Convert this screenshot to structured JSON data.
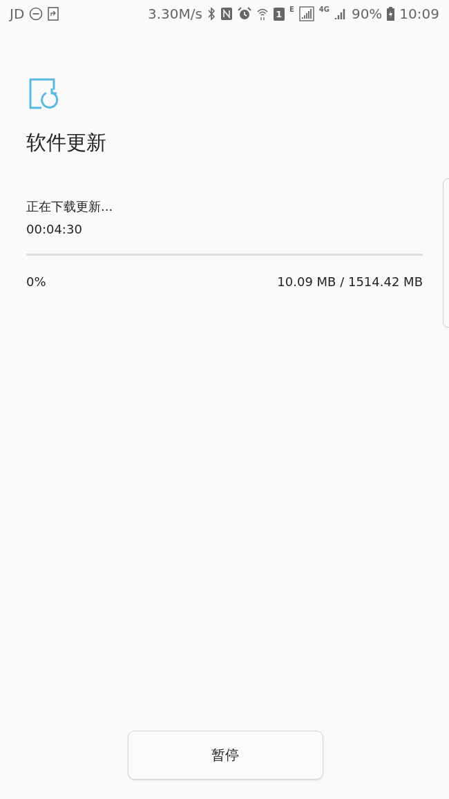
{
  "status_bar": {
    "carrier": "JD",
    "speed": "3.30M/s",
    "sim_slot": "1",
    "network_e": "E",
    "network_4g": "4G",
    "battery": "90%",
    "time": "10:09"
  },
  "title": "软件更新",
  "download": {
    "status": "正在下载更新...",
    "elapsed": "00:04:30",
    "percent": "0%",
    "size": "10.09 MB / 1514.42 MB"
  },
  "buttons": [
    {
      "label": "暂停"
    }
  ]
}
